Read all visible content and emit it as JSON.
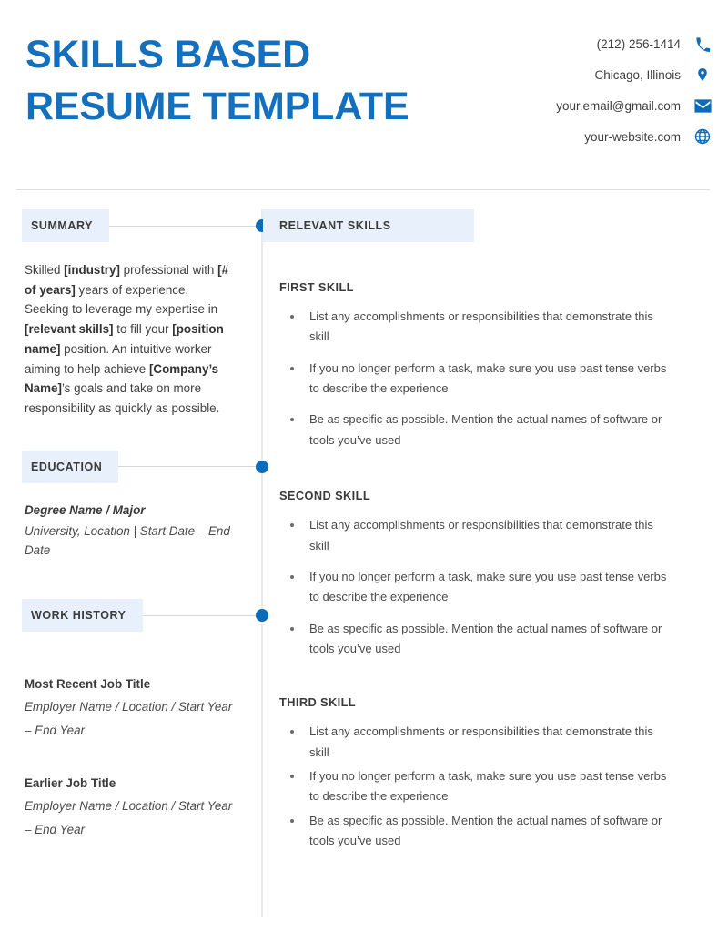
{
  "header": {
    "title_lines": [
      "SKILLS BASED",
      "RESUME TEMPLATE"
    ],
    "accent_color": "#1470bd",
    "contacts": [
      {
        "icon": "phone-icon",
        "text": "(212) 256-1414"
      },
      {
        "icon": "location-pin-icon",
        "text": "Chicago, Illinois"
      },
      {
        "icon": "envelope-icon",
        "text": "your.email@gmail.com"
      },
      {
        "icon": "globe-icon",
        "text": "your-website.com"
      }
    ]
  },
  "left_column": {
    "summary": {
      "heading": "SUMMARY",
      "paragraph_html": "Skilled <b>[industry]</b> professional with <b>[# of years]</b> years of experience. Seeking to leverage my expertise in <b>[relevant skills]</b> to fill your <b>[position name]</b> position. An intuitive worker aiming to help achieve <b>[Company&rsquo;s Name]</b>&rsquo;s goals and take on more responsibility as quickly as possible.",
      "paragraph_text": "Skilled [industry] professional with [# of years] years of experience. Seeking to leverage my expertise in [relevant skills] to fill your [position name] position. An intuitive worker aiming to help achieve [Company's Name]'s goals and take on more responsibility as quickly as possible."
    },
    "education": {
      "heading": "EDUCATION",
      "entries": [
        {
          "title": "Degree Name / Major",
          "subtitle": "University, Location | Start Date – End Date"
        }
      ]
    },
    "work_history": {
      "heading": "WORK HISTORY",
      "entries": [
        {
          "title": "Most Recent Job Title",
          "subtitle": "Employer Name / Location / Start Year – End Year"
        },
        {
          "title": "Earlier Job Title",
          "subtitle": "Employer Name / Location / Start Year – End Year"
        }
      ]
    }
  },
  "right_column": {
    "heading": "RELEVANT SKILLS",
    "skills": [
      {
        "title": "FIRST SKILL",
        "bullets": [
          "List any accomplishments or responsibilities that demonstrate this skill",
          "If you no longer perform a task, make sure you use past tense verbs to describe the experience",
          "Be as specific as possible. Mention the actual names of software or tools you’ve used"
        ]
      },
      {
        "title": "SECOND SKILL",
        "bullets": [
          "List any accomplishments or responsibilities that demonstrate this skill",
          "If you no longer perform a task, make sure you use past tense verbs to describe the experience",
          "Be as specific as possible. Mention the actual names of software or tools you’ve used"
        ]
      },
      {
        "title": "THIRD SKILL",
        "bullets": [
          "List any accomplishments or responsibilities that demonstrate this skill",
          "If you no longer perform a task, make sure you use past tense verbs to describe the experience",
          "Be as specific as possible. Mention the actual names of software or tools you’ve used"
        ]
      }
    ]
  },
  "theme": {
    "accent_blue": "#0d6cba",
    "chip_background": "#e8f1fb",
    "divider_gray": "#ebebeb",
    "text_gray": "#3f3f3f"
  }
}
